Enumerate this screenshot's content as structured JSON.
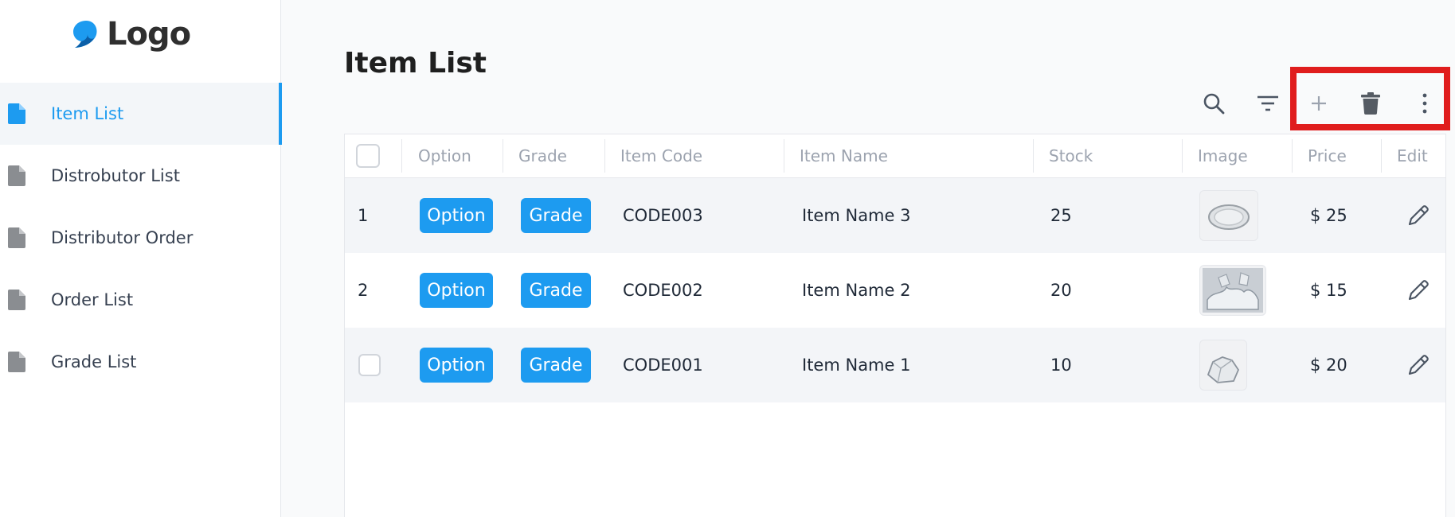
{
  "logo": {
    "text": "Logo",
    "icon": "logo-mark-icon",
    "color": "#1d9bf0"
  },
  "sidebar": {
    "items": [
      {
        "label": "Item List",
        "icon": "document-icon",
        "active": true
      },
      {
        "label": "Distrobutor List",
        "icon": "document-icon",
        "active": false
      },
      {
        "label": "Distributor Order",
        "icon": "document-icon",
        "active": false
      },
      {
        "label": "Order List",
        "icon": "document-icon",
        "active": false
      },
      {
        "label": "Grade List",
        "icon": "document-icon",
        "active": false
      }
    ]
  },
  "page": {
    "title": "Item List"
  },
  "toolbar": {
    "icons": [
      "search-icon",
      "filter-icon",
      "add-icon",
      "delete-icon",
      "more-vertical-icon"
    ]
  },
  "table": {
    "columns": [
      "Option",
      "Grade",
      "Item Code",
      "Item Name",
      "Stock",
      "Image",
      "Price",
      "Edit"
    ],
    "rows": [
      {
        "index": "1",
        "option": "Option",
        "grade": "Grade",
        "code": "CODE003",
        "name": "Item Name 3",
        "stock": "25",
        "image": "plate-thumbnail",
        "price": "$ 25"
      },
      {
        "index": "2",
        "option": "Option",
        "grade": "Grade",
        "code": "CODE002",
        "name": "Item Name 2",
        "stock": "20",
        "image": "glass-pieces-thumbnail",
        "price": "$ 15"
      },
      {
        "index": "",
        "option": "Option",
        "grade": "Grade",
        "code": "CODE001",
        "name": "Item Name 1",
        "stock": "10",
        "image": "glass-chunk-thumbnail",
        "price": "$ 20"
      }
    ]
  },
  "colors": {
    "accent": "#1d9bf0",
    "highlight": "#e01d1d",
    "row_shade": "#f3f5f8"
  }
}
